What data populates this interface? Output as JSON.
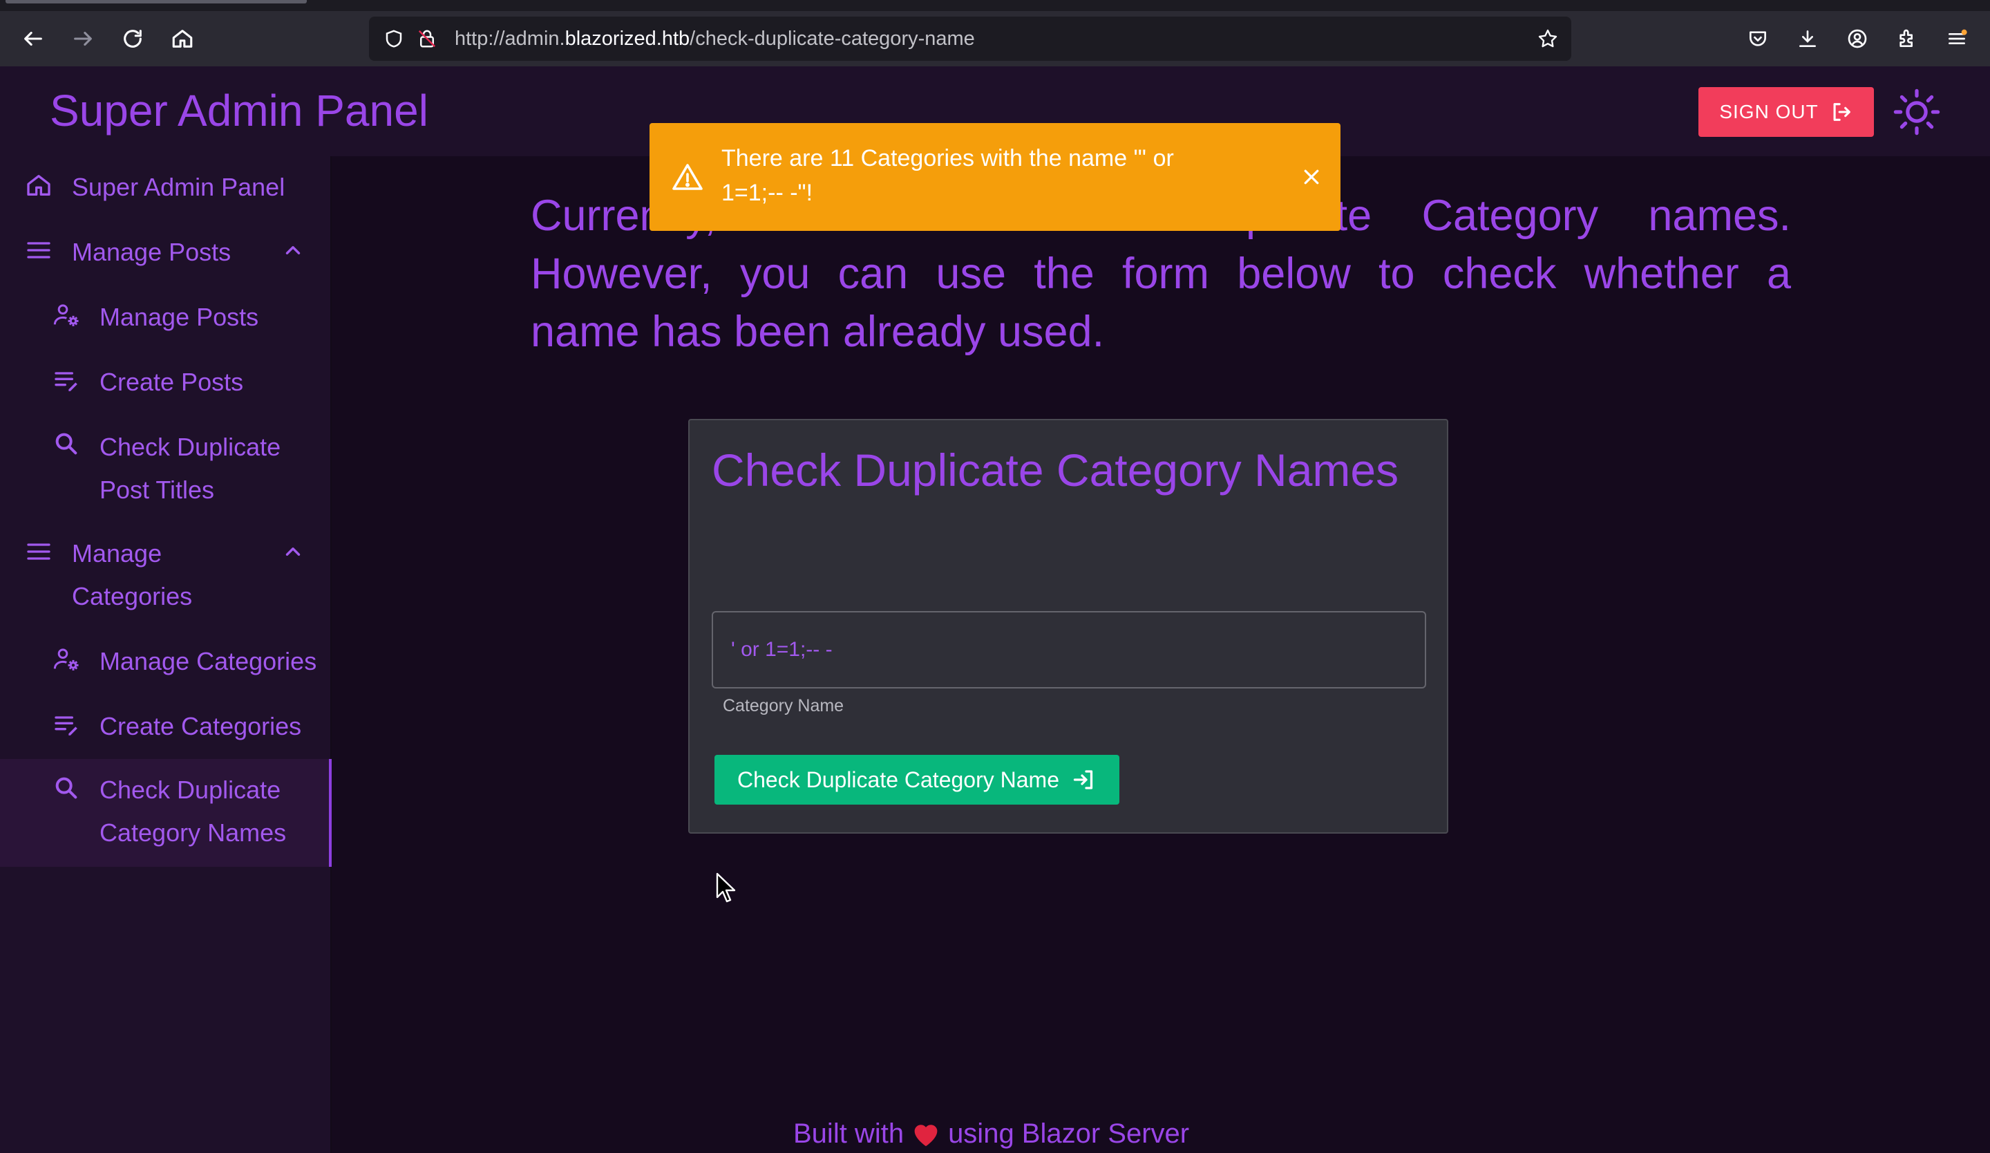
{
  "browser": {
    "url_prefix": "http://admin.",
    "url_host": "blazorized.htb",
    "url_path": "/check-duplicate-category-name"
  },
  "header": {
    "title": "Super Admin Panel",
    "sign_out_label": "SIGN OUT"
  },
  "sidebar": {
    "items": [
      {
        "label": "Super Admin Panel",
        "icon": "home-icon"
      },
      {
        "label": "Manage Posts",
        "icon": "menu-icon",
        "expanded": true
      },
      {
        "label": "Manage Posts",
        "icon": "user-settings-icon"
      },
      {
        "label": "Create Posts",
        "icon": "edit-list-icon"
      },
      {
        "label_line1": "Check Duplicate",
        "label_line2": "Post Titles",
        "icon": "search-icon"
      },
      {
        "label_line1": "Manage",
        "label_line2": "Categories",
        "icon": "menu-icon",
        "expanded": true
      },
      {
        "label": "Manage Categories",
        "icon": "user-settings-icon"
      },
      {
        "label": "Create Categories",
        "icon": "edit-list-icon"
      },
      {
        "label_line1": "Check Duplicate",
        "label_line2": "Category Names",
        "icon": "search-icon",
        "active": true
      }
    ]
  },
  "main": {
    "intro_line1": "Currently, Blazorized allows Duplicate Category names.",
    "intro_line2": "However, you can use the form below to check whether a",
    "intro_line3": "name has been already used.",
    "form_title": "Check Duplicate Category Names",
    "input_value": "' or 1=1;-- -",
    "input_label": "Category Name",
    "button_label": "Check Duplicate Category Name"
  },
  "toast": {
    "line1": "There are 11 Categories with the name \"' or",
    "line2": "1=1;-- -\"!",
    "type": "warning",
    "color": "#f59e0b"
  },
  "footer": {
    "text_before": "Built with",
    "text_after": "using Blazor Server",
    "heart_icon": "heart-icon"
  },
  "colors": {
    "accent": "#9a46e8",
    "danger": "#f23d5b",
    "success": "#08b77c",
    "warning": "#f59e0b",
    "background": "#150a1d",
    "panel": "#1e1029"
  }
}
